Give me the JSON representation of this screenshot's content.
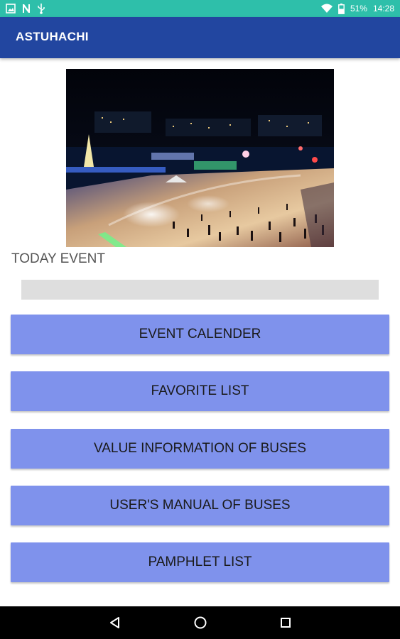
{
  "status_bar": {
    "battery_text": "51%",
    "time": "14:28",
    "left_icons": [
      "image-icon",
      "n-icon",
      "usb-icon"
    ],
    "right_icons": [
      "wifi-icon",
      "battery-icon"
    ]
  },
  "app_bar": {
    "title": "ASTUHACHI",
    "color": "#2246a0"
  },
  "hero": {
    "description_icon": "event-photo-image"
  },
  "today_event": {
    "label": "TODAY EVENT",
    "value": ""
  },
  "menu": {
    "button_color": "#7f92ec",
    "items": [
      {
        "label": "EVENT CALENDER"
      },
      {
        "label": "FAVORITE LIST"
      },
      {
        "label": "VALUE INFORMATION OF BUSES"
      },
      {
        "label": "USER'S MANUAL OF BUSES"
      },
      {
        "label": "PAMPHLET LIST"
      }
    ]
  },
  "nav_bar": {
    "buttons": [
      "back-icon",
      "home-icon",
      "recents-icon"
    ]
  }
}
